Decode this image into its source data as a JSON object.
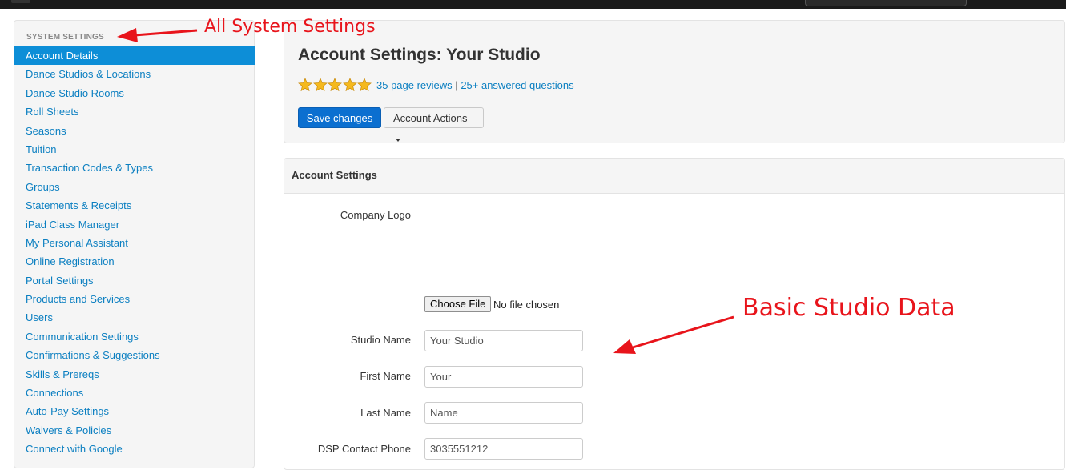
{
  "sidebar": {
    "header": "SYSTEM SETTINGS",
    "items": [
      {
        "label": "Account Details",
        "active": true
      },
      {
        "label": "Dance Studios & Locations"
      },
      {
        "label": "Dance Studio Rooms"
      },
      {
        "label": "Roll Sheets"
      },
      {
        "label": "Seasons"
      },
      {
        "label": "Tuition"
      },
      {
        "label": "Transaction Codes & Types"
      },
      {
        "label": "Groups"
      },
      {
        "label": "Statements & Receipts"
      },
      {
        "label": "iPad Class Manager"
      },
      {
        "label": "My Personal Assistant"
      },
      {
        "label": "Online Registration"
      },
      {
        "label": "Portal Settings"
      },
      {
        "label": "Products and Services"
      },
      {
        "label": "Users"
      },
      {
        "label": "Communication Settings"
      },
      {
        "label": "Confirmations & Suggestions"
      },
      {
        "label": "Skills & Prereqs"
      },
      {
        "label": "Connections"
      },
      {
        "label": "Auto-Pay Settings"
      },
      {
        "label": "Waivers & Policies"
      },
      {
        "label": "Connect with Google"
      }
    ]
  },
  "header": {
    "title": "Account Settings: Your Studio",
    "rating": 5,
    "reviews_link": "35 page reviews",
    "separator": "|",
    "questions_link": "25+ answered questions",
    "save_label": "Save changes",
    "actions_label": "Account Actions"
  },
  "settings": {
    "heading": "Account Settings",
    "logo_label": "Company Logo",
    "file_button": "Choose File",
    "file_status": "No file chosen",
    "fields": {
      "studio_name": {
        "label": "Studio Name",
        "value": "Your Studio"
      },
      "first_name": {
        "label": "First Name",
        "value": "Your"
      },
      "last_name": {
        "label": "Last Name",
        "value": "Name"
      },
      "contact_phone": {
        "label": "DSP Contact Phone",
        "value": "3035551212"
      }
    }
  },
  "annotations": {
    "system_settings": "All System Settings",
    "basic_data": "Basic Studio Data",
    "color": "#e8141b"
  },
  "colors": {
    "accent": "#0d8ed7",
    "link": "#0b7fc1",
    "save_button": "#0b6fd0",
    "star": "#f5b91e"
  }
}
